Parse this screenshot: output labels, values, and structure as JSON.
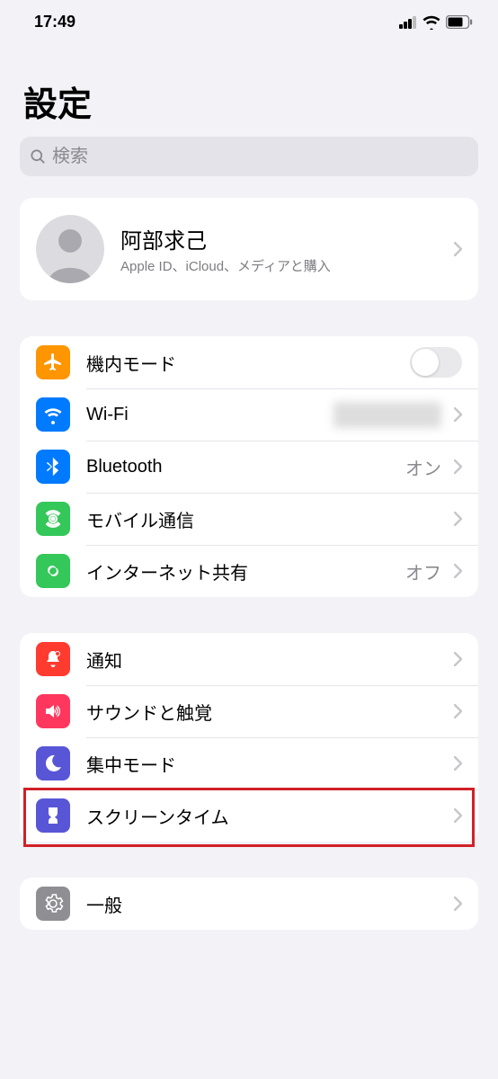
{
  "status": {
    "time": "17:49"
  },
  "page": {
    "title": "設定"
  },
  "search": {
    "placeholder": "検索"
  },
  "profile": {
    "name": "阿部求己",
    "subtitle": "Apple ID、iCloud、メディアと購入"
  },
  "groupA": {
    "airplane": {
      "label": "機内モード"
    },
    "wifi": {
      "label": "Wi-Fi",
      "value": "　　　"
    },
    "bluetooth": {
      "label": "Bluetooth",
      "value": "オン"
    },
    "cellular": {
      "label": "モバイル通信"
    },
    "hotspot": {
      "label": "インターネット共有",
      "value": "オフ"
    }
  },
  "groupB": {
    "notifications": {
      "label": "通知"
    },
    "sounds": {
      "label": "サウンドと触覚"
    },
    "focus": {
      "label": "集中モード"
    },
    "screentime": {
      "label": "スクリーンタイム"
    }
  },
  "groupC": {
    "general": {
      "label": "一般"
    }
  }
}
